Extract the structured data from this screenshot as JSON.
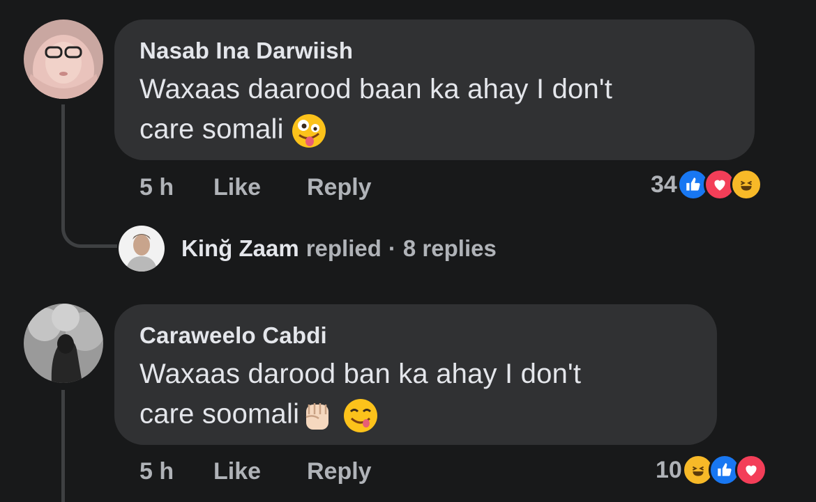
{
  "comments": [
    {
      "author": "Nasab Ina Darwiish",
      "text_line1": "Waxaas daarood baan ka ahay I don't",
      "text_line2": "care somali",
      "emojis": [
        "zany-face-emoji"
      ],
      "time": "5 h",
      "like_label": "Like",
      "reply_label": "Reply",
      "reaction_count": "34",
      "reaction_icons": [
        "like-reaction-icon",
        "love-reaction-icon",
        "haha-reaction-icon"
      ]
    },
    {
      "author": "Caraweelo Cabdi",
      "text_line1": "Waxaas darood ban ka ahay I don't",
      "text_line2": "care soomali",
      "emojis": [
        "raised-fist-emoji",
        "yum-face-emoji"
      ],
      "time": "5 h",
      "like_label": "Like",
      "reply_label": "Reply",
      "reaction_count": "10",
      "reaction_icons": [
        "haha-reaction-icon",
        "like-reaction-icon",
        "love-reaction-icon"
      ]
    }
  ],
  "reply_summary": {
    "name": "Kinğ Zaam",
    "action": "replied",
    "separator": "·",
    "count_text": "8 replies"
  },
  "colors": {
    "background": "#18191a",
    "bubble": "#303133",
    "primary_text": "#e4e6eb",
    "secondary_text": "#b0b3b8",
    "like_blue": "#1877f2",
    "love_red": "#f33e58",
    "haha_yellow": "#f7b928"
  }
}
